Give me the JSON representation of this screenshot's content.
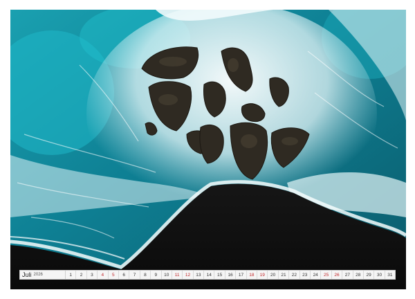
{
  "photo": {
    "subject": "aerial-ocean-waves-black-sand-rocks"
  },
  "calendar": {
    "month": "Juli",
    "year": "2026",
    "days": [
      "1",
      "2",
      "3",
      "4",
      "5",
      "6",
      "7",
      "8",
      "9",
      "10",
      "11",
      "12",
      "13",
      "14",
      "15",
      "16",
      "17",
      "18",
      "19",
      "20",
      "21",
      "22",
      "23",
      "24",
      "25",
      "26",
      "27",
      "28",
      "29",
      "30",
      "31"
    ],
    "weekend_days": [
      "4",
      "5",
      "11",
      "12",
      "18",
      "19",
      "25",
      "26"
    ],
    "colors": {
      "weekday": "#333333",
      "weekend": "#c0282b"
    }
  }
}
